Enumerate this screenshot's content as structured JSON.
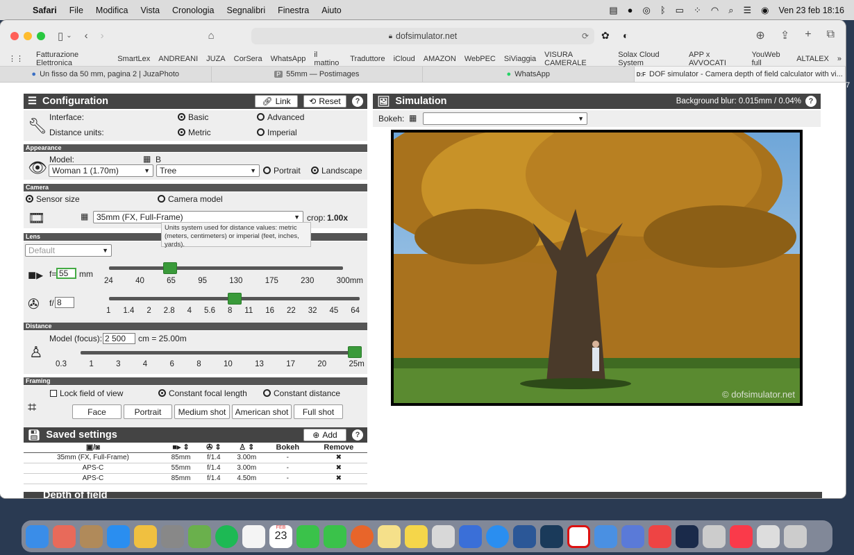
{
  "menubar": {
    "app": "Safari",
    "items": [
      "File",
      "Modifica",
      "Vista",
      "Cronologia",
      "Segnalibri",
      "Finestra",
      "Aiuto"
    ],
    "datetime": "Ven 23 feb  18:16"
  },
  "browser": {
    "url": "dofsimulator.net",
    "favorites": [
      "Fatturazione Elettronica",
      "SmartLex",
      "ANDREANI",
      "JUZA",
      "CorSera",
      "WhatsApp",
      "il mattino",
      "Traduttore",
      "iCloud",
      "AMAZON",
      "WebPEC",
      "SiViaggia",
      "VISURA CAMERALE",
      "Solax Cloud System",
      "APP x AVVOCATI",
      "YouWeb full",
      "ALTALEX"
    ],
    "tabs": [
      "Un fisso da 50 mm, pagina 2 | JuzaPhoto",
      "55mm — Postimages",
      "WhatsApp",
      "DOF simulator - Camera depth of field calculator with vi..."
    ]
  },
  "config": {
    "title": "Configuration",
    "link": "Link",
    "reset": "Reset",
    "help": "?",
    "interface_label": "Interface:",
    "basic": "Basic",
    "advanced": "Advanced",
    "units_label": "Distance units:",
    "metric": "Metric",
    "imperial": "Imperial",
    "tooltip": "Units system used for distance values: metric (meters, centimeters) or imperial (feet, inches, yards).",
    "appearance": "Appearance",
    "model_label": "Model:",
    "model_value": "Woman 1 (1.70m)",
    "bg_prefix": "B",
    "bg_value": "Tree",
    "portrait": "Portrait",
    "landscape": "Landscape",
    "camera": "Camera",
    "sensor_size": "Sensor size",
    "camera_model": "Camera model",
    "sensor_value": "35mm (FX, Full-Frame)",
    "crop_label": "crop:",
    "crop_value": "1.00x",
    "lens": "Lens",
    "lens_value": "Default",
    "focal_prefix": "f=",
    "focal_value": "55",
    "focal_unit": "mm",
    "focal_ticks": [
      "24",
      "40",
      "65",
      "95",
      "130",
      "175",
      "230",
      "300mm"
    ],
    "focal_pos": 0.26,
    "aperture_prefix": "f/",
    "aperture_value": "8",
    "aperture_ticks": [
      "1",
      "1.4",
      "2",
      "2.8",
      "4",
      "5.6",
      "8",
      "11",
      "16",
      "22",
      "32",
      "45",
      "64"
    ],
    "aperture_pos": 0.5,
    "distance": "Distance",
    "focus_label": "Model (focus):",
    "focus_value": "2 500",
    "focus_result": "cm = 25.00m",
    "distance_ticks": [
      "0.3",
      "1",
      "3",
      "4",
      "6",
      "8",
      "10",
      "13",
      "17",
      "20",
      "25m"
    ],
    "distance_pos": 1.0,
    "framing": "Framing",
    "lock_fov": "Lock field of view",
    "const_focal": "Constant focal length",
    "const_dist": "Constant distance",
    "frame_buttons": [
      "Face",
      "Portrait",
      "Medium shot",
      "American shot",
      "Full shot"
    ]
  },
  "saved": {
    "title": "Saved settings",
    "add": "Add",
    "help": "?",
    "col_bokeh": "Bokeh",
    "col_remove": "Remove",
    "rows": [
      [
        "35mm (FX, Full-Frame)",
        "85mm",
        "f/1.4",
        "3.00m",
        "-",
        "✖"
      ],
      [
        "APS-C",
        "55mm",
        "f/1.4",
        "3.00m",
        "-",
        "✖"
      ],
      [
        "APS-C",
        "85mm",
        "f/1.4",
        "4.50m",
        "-",
        "✖"
      ]
    ]
  },
  "simulation": {
    "title": "Simulation",
    "bg_blur": "Background blur: 0.015mm / 0.04%",
    "help": "?",
    "bokeh_label": "Bokeh:",
    "watermark": "© dofsimulator.net"
  },
  "dof": {
    "title": "Depth of field"
  },
  "sidebar_num": "7",
  "calendar_month": "FEB",
  "calendar_day": "23",
  "colors": {
    "header": "#444444",
    "slider": "#3a9a3a"
  }
}
